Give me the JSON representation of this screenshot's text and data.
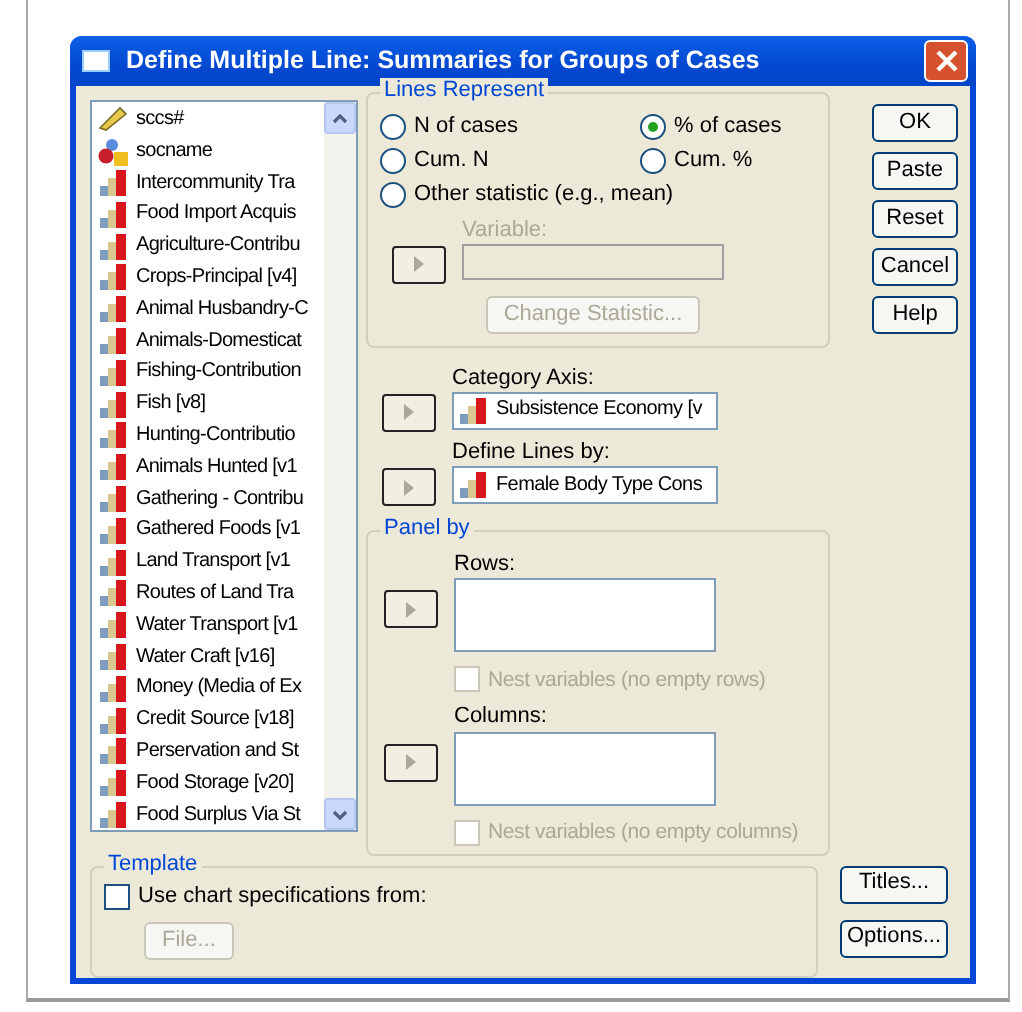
{
  "window": {
    "title": "Define Multiple Line: Summaries for Groups of Cases"
  },
  "variables": [
    {
      "kind": "scale",
      "label": "sccs#"
    },
    {
      "kind": "string",
      "label": "socname"
    },
    {
      "kind": "ordinal",
      "label": "Intercommunity Tra"
    },
    {
      "kind": "ordinal",
      "label": "Food Import Acquis"
    },
    {
      "kind": "ordinal",
      "label": "Agriculture-Contribu"
    },
    {
      "kind": "ordinal",
      "label": "Crops-Principal [v4]"
    },
    {
      "kind": "ordinal",
      "label": "Animal Husbandry-C"
    },
    {
      "kind": "ordinal",
      "label": "Animals-Domesticat"
    },
    {
      "kind": "ordinal",
      "label": "Fishing-Contribution"
    },
    {
      "kind": "ordinal",
      "label": "Fish [v8]"
    },
    {
      "kind": "ordinal",
      "label": "Hunting-Contributio"
    },
    {
      "kind": "ordinal",
      "label": "Animals Hunted [v1"
    },
    {
      "kind": "ordinal",
      "label": "Gathering - Contribu"
    },
    {
      "kind": "ordinal",
      "label": "Gathered Foods [v1"
    },
    {
      "kind": "ordinal",
      "label": "Land Transport [v1"
    },
    {
      "kind": "ordinal",
      "label": "Routes of Land Tra"
    },
    {
      "kind": "ordinal",
      "label": "Water Transport [v1"
    },
    {
      "kind": "ordinal",
      "label": "Water Craft [v16]"
    },
    {
      "kind": "ordinal",
      "label": "Money (Media of Ex"
    },
    {
      "kind": "ordinal",
      "label": "Credit Source [v18]"
    },
    {
      "kind": "ordinal",
      "label": "Perservation and St"
    },
    {
      "kind": "ordinal",
      "label": "Food Storage [v20]"
    },
    {
      "kind": "ordinal",
      "label": "Food Surplus Via St"
    }
  ],
  "lines_represent": {
    "title": "Lines Represent",
    "options": [
      {
        "label": "N of cases",
        "selected": false
      },
      {
        "label": "% of cases",
        "selected": true
      },
      {
        "label": "Cum. N",
        "selected": false
      },
      {
        "label": "Cum. %",
        "selected": false
      },
      {
        "label": "Other statistic (e.g., mean)",
        "selected": false
      }
    ],
    "variable_label": "Variable:",
    "variable_disabled": true,
    "change_statistic": {
      "label": "Change Statistic...",
      "disabled": true
    }
  },
  "category_axis": {
    "label": "Category Axis:",
    "value": "Subsistence Economy [v",
    "kind": "ordinal"
  },
  "define_lines_by": {
    "label": "Define Lines by:",
    "value": "Female Body Type Cons",
    "kind": "ordinal"
  },
  "panel_by": {
    "title": "Panel by",
    "rows": {
      "label": "Rows:",
      "nest_label": "Nest variables (no empty rows)",
      "nest_checked": false,
      "nest_disabled": true
    },
    "columns": {
      "label": "Columns:",
      "nest_label": "Nest variables (no empty columns)",
      "nest_checked": false,
      "nest_disabled": true
    }
  },
  "buttons": [
    "OK",
    "Paste",
    "Reset",
    "Cancel",
    "Help"
  ],
  "template": {
    "title": "Template",
    "checkbox_label": "Use chart specifications from:",
    "checked": false,
    "file_button": {
      "label": "File...",
      "disabled": true
    }
  },
  "side_buttons": [
    "Titles...",
    "Options..."
  ]
}
